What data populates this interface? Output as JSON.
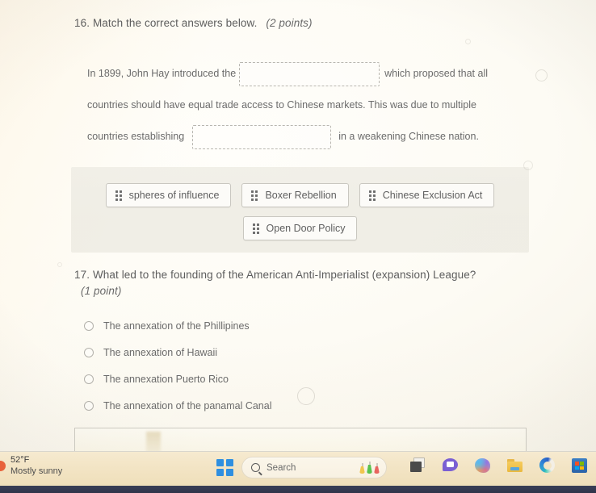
{
  "document": {
    "questions": [
      {
        "number": "16.",
        "prompt": "Match the correct answers below.",
        "points": "(2 points)",
        "type": "drag-and-drop-fill-in",
        "passage": {
          "segment_1": "In 1899, John Hay introduced the",
          "blank_1_value": "",
          "segment_2": "which proposed that all",
          "segment_3": "countries should have equal trade access to Chinese markets.  This was due to multiple",
          "segment_4": "countries establishing",
          "blank_2_value": "",
          "segment_5": "in a weakening Chinese nation."
        },
        "options": [
          {
            "label": "spheres of influence",
            "handle": "drag-handle-icon"
          },
          {
            "label": "Boxer Rebellion",
            "handle": "drag-handle-icon"
          },
          {
            "label": "Chinese Exclusion Act",
            "handle": "drag-handle-icon"
          },
          {
            "label": "Open Door Policy",
            "handle": "drag-handle-icon"
          }
        ]
      },
      {
        "number": "17.",
        "prompt": "What led to the founding of the American Anti-Imperialist (expansion) League?",
        "points": "(1 point)",
        "type": "multiple-choice",
        "choices": [
          {
            "label": "The annexation of the Phillipines",
            "selected": false
          },
          {
            "label": "The annexation of Hawaii",
            "selected": false
          },
          {
            "label": "The annexation Puerto Rico",
            "selected": false
          },
          {
            "label": "The annexation of the panamal Canal",
            "selected": false
          }
        ]
      }
    ]
  },
  "taskbar": {
    "weather": {
      "temperature": "52°F",
      "condition": "Mostly sunny",
      "icon": "sun-icon"
    },
    "start": {
      "icon": "windows-start-icon",
      "label": "Start"
    },
    "search": {
      "icon": "search-icon",
      "placeholder": "Search",
      "value": "Search",
      "trailing_icon": "science-flasks-icon"
    },
    "pinned": [
      {
        "name": "task-view",
        "icon": "task-view-icon"
      },
      {
        "name": "chat",
        "icon": "chat-bubble-icon"
      },
      {
        "name": "copilot",
        "icon": "copilot-icon"
      },
      {
        "name": "file-explorer",
        "icon": "folder-icon"
      },
      {
        "name": "microsoft-edge",
        "icon": "edge-icon"
      },
      {
        "name": "microsoft-store",
        "icon": "store-icon"
      }
    ]
  },
  "colors": {
    "page_background": "#fdfbf4",
    "taskbar_background": "#f3e5c6",
    "text": "#6b6b6b",
    "tray_background": "#eeece4",
    "accent_blue": "#2f8fe0"
  }
}
